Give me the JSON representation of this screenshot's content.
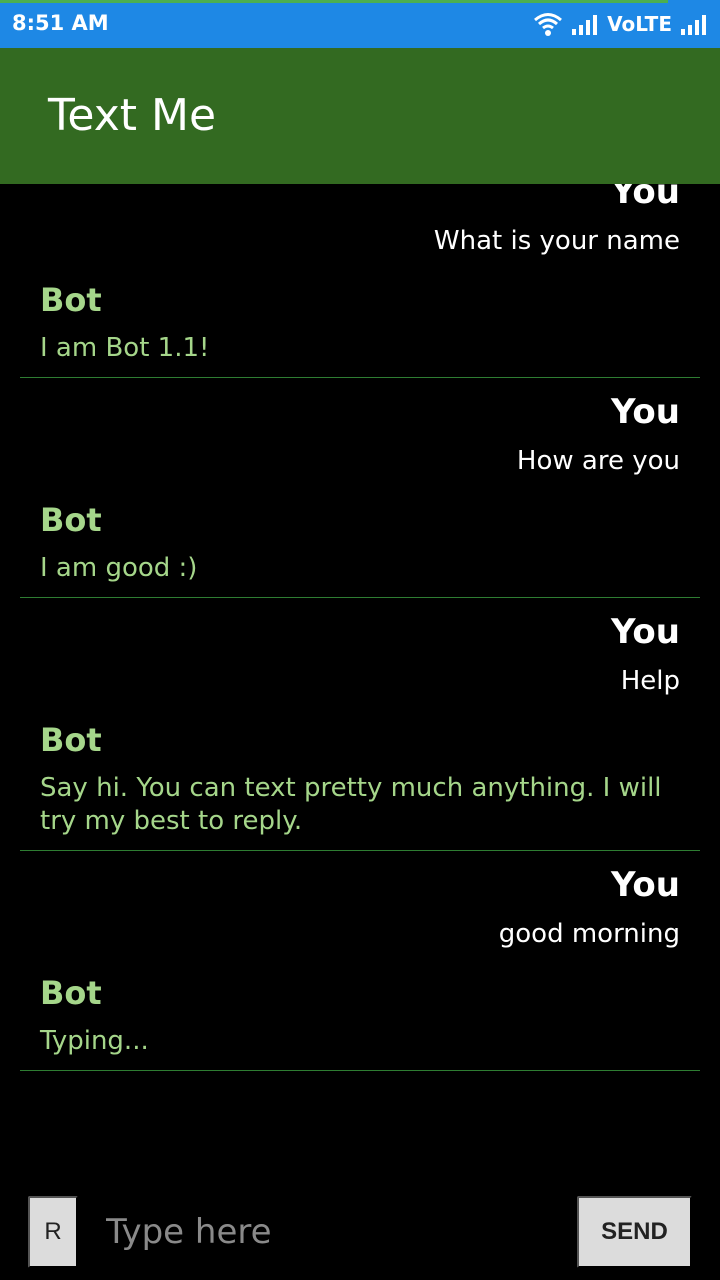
{
  "status_bar": {
    "time": "8:51 AM",
    "network": "VoLTE",
    "icons": [
      "wifi-icon",
      "signal-icon",
      "signal-icon"
    ]
  },
  "app_bar": {
    "title": "Text Me"
  },
  "chat": {
    "exchanges": [
      {
        "you_label": "You",
        "you_message": "What is your name",
        "bot_label": "Bot",
        "bot_message": "I am Bot 1.1!"
      },
      {
        "you_label": "You",
        "you_message": "How are you",
        "bot_label": "Bot",
        "bot_message": "I am good :)"
      },
      {
        "you_label": "You",
        "you_message": "Help",
        "bot_label": "Bot",
        "bot_message": "Say hi. You can text pretty much anything. I will try my best to reply."
      },
      {
        "you_label": "You",
        "you_message": "good morning",
        "bot_label": "Bot",
        "bot_message": "Typing..."
      }
    ]
  },
  "composer": {
    "r_button_label": "R",
    "input_placeholder": "Type here",
    "input_value": "",
    "send_label": "SEND"
  },
  "colors": {
    "status_bar": "#1e88e5",
    "app_bar": "#336a21",
    "bot_text": "#a5d68a",
    "divider": "#2e7d32",
    "background": "#000000"
  }
}
